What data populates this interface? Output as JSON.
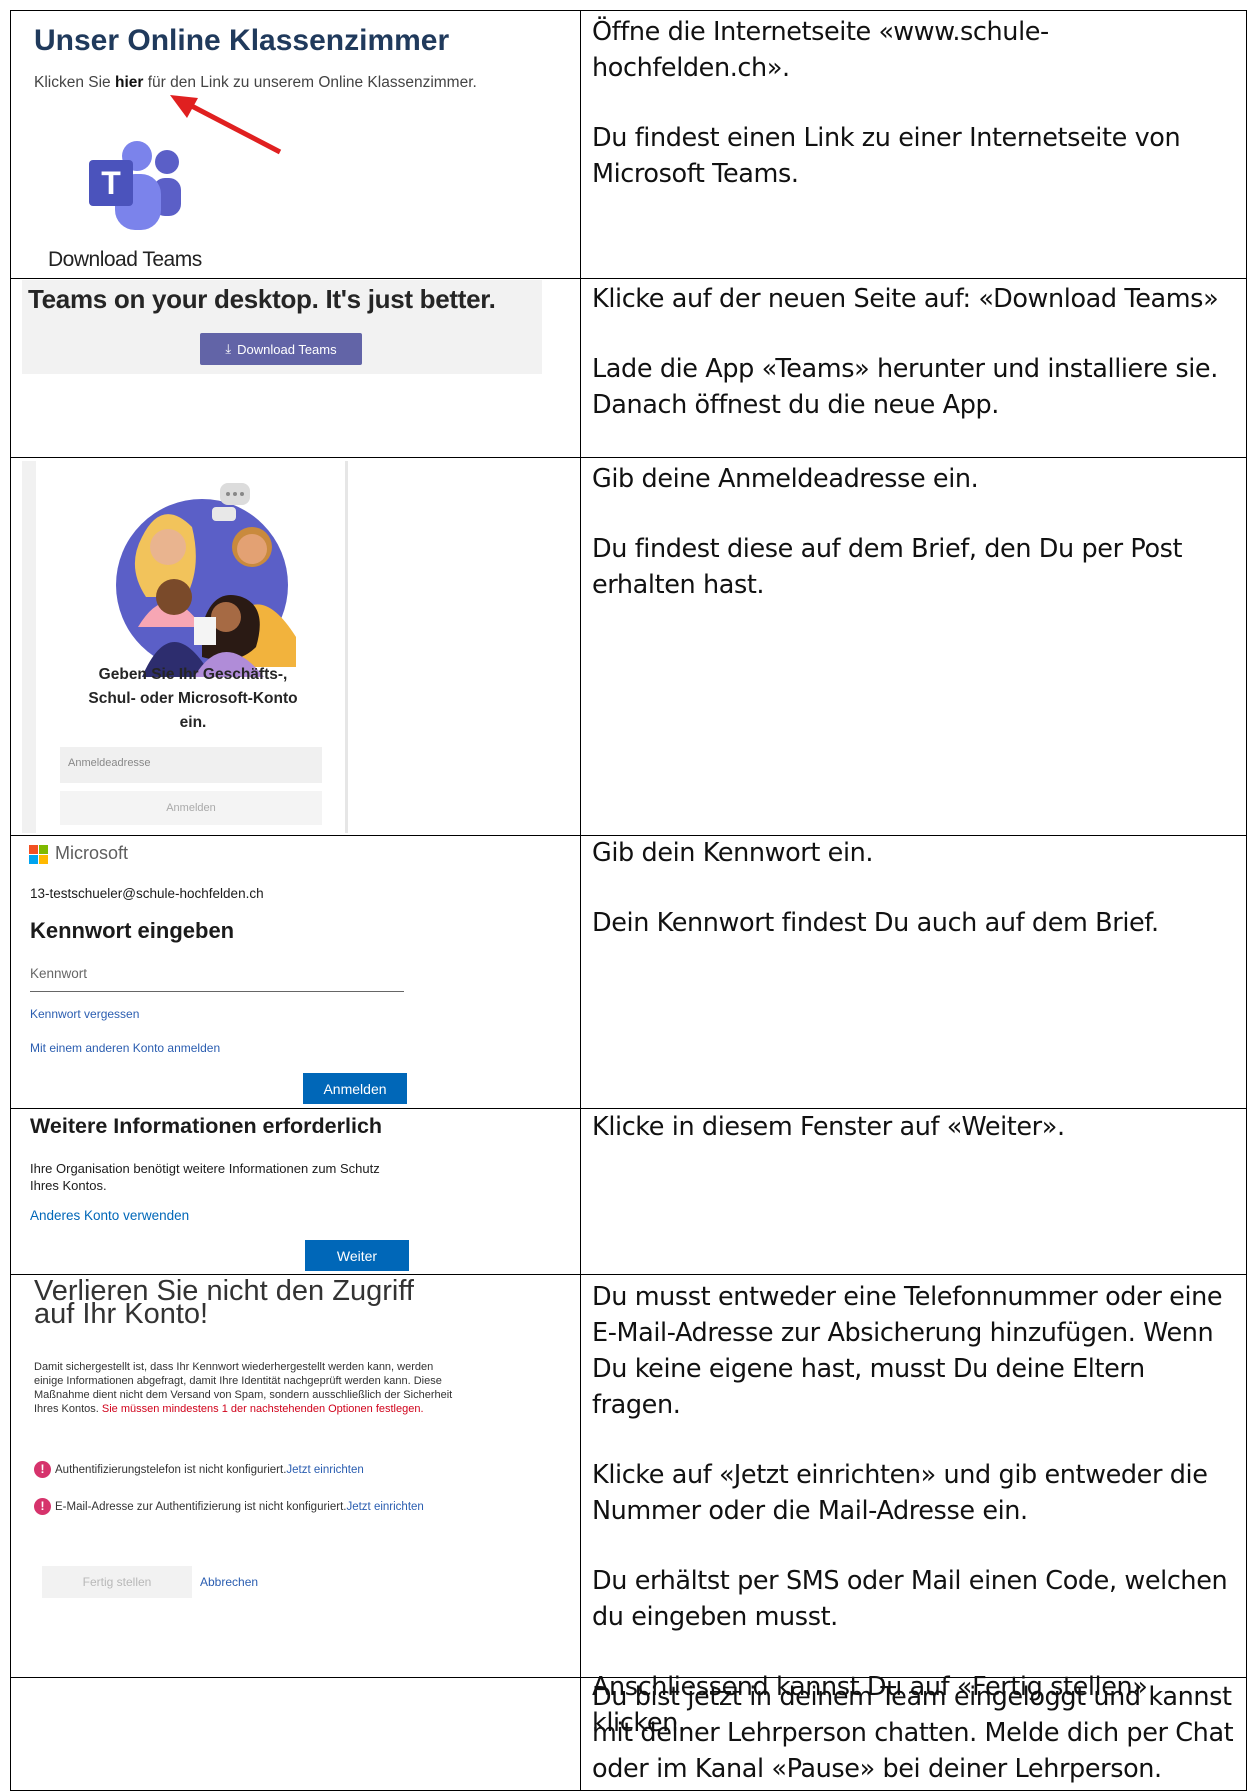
{
  "rows": [
    {
      "screenshot": {
        "title": "Unser Online Klassenzimmer",
        "text_before": "Klicken Sie ",
        "text_bold": "hier",
        "text_after": " für den Link zu unserem Online Klassenzimmer.",
        "app_label": "Download Teams",
        "arrow_color": "#e02020"
      },
      "instructions": [
        "Öffne die Internetseite «www.schule-hochfelden.ch».",
        "Du findest einen Link zu einer Internetseite von Microsoft Teams."
      ]
    },
    {
      "screenshot": {
        "headline": "Teams on your desktop. It's just better.",
        "button_label": "Download Teams"
      },
      "instructions": [
        "Klicke auf der neuen Seite auf: «Download Teams»",
        "Lade die App «Teams» herunter und installiere sie. Danach öffnest du die neue App."
      ]
    },
    {
      "screenshot": {
        "prompt": "Geben Sie Ihr Geschäfts-, Schul- oder Microsoft-Konto ein.",
        "input_placeholder": "Anmeldeadresse",
        "button_label": "Anmelden"
      },
      "instructions": [
        "Gib deine Anmeldeadresse ein.",
        "Du findest diese auf dem Brief, den Du per Post erhalten hast."
      ]
    },
    {
      "screenshot": {
        "brand": "Microsoft",
        "account": "13-testschueler@schule-hochfelden.ch",
        "heading": "Kennwort eingeben",
        "password_placeholder": "Kennwort",
        "forgot_link": "Kennwort vergessen",
        "other_account_link": "Mit einem anderen Konto anmelden",
        "button_label": "Anmelden"
      },
      "instructions": [
        "Gib dein Kennwort ein.",
        "Dein Kennwort findest Du auch auf dem Brief."
      ]
    },
    {
      "screenshot": {
        "heading": "Weitere Informationen erforderlich",
        "text": "Ihre Organisation benötigt weitere Informationen zum Schutz Ihres Kontos.",
        "link": "Anderes Konto verwenden",
        "button_label": "Weiter"
      },
      "instructions": [
        "Klicke in diesem Fenster auf «Weiter»."
      ]
    },
    {
      "screenshot": {
        "heading": "Verlieren Sie nicht den Zugriff auf Ihr Konto!",
        "body": "Damit sichergestellt ist, dass Ihr Kennwort wiederhergestellt werden kann, werden einige Informationen abgefragt, damit Ihre Identität nachgeprüft werden kann. Diese Maßnahme dient nicht dem Versand von Spam, sondern ausschließlich der Sicherheit Ihres Kontos. ",
        "body_red": "Sie müssen mindestens 1 der nachstehenden Optionen festlegen.",
        "item1_text": "Authentifizierungstelefon ist nicht konfiguriert. ",
        "item1_link": "Jetzt einrichten",
        "item2_text": "E-Mail-Adresse zur Authentifizierung ist nicht konfiguriert. ",
        "item2_link": "Jetzt einrichten",
        "finish_button": "Fertig stellen",
        "cancel_link": "Abbrechen"
      },
      "instructions": [
        "Du musst entweder eine Telefonnummer oder eine E-Mail-Adresse zur Absicherung hinzufügen. Wenn Du keine eigene hast, musst Du deine Eltern fragen.",
        "Klicke auf «Jetzt einrichten» und gib entweder die Nummer oder die Mail-Adresse ein.",
        "Du erhältst per SMS oder Mail einen Code, welchen du eingeben musst.",
        "Anschliessend kannst Du auf «Fertig stellen» klicken."
      ]
    },
    {
      "instructions": [
        "Du bist jetzt in deinem Team eingeloggt und kannst mit deiner Lehrperson chatten. Melde dich per Chat oder im Kanal «Pause» bei deiner Lehrperson."
      ]
    }
  ]
}
